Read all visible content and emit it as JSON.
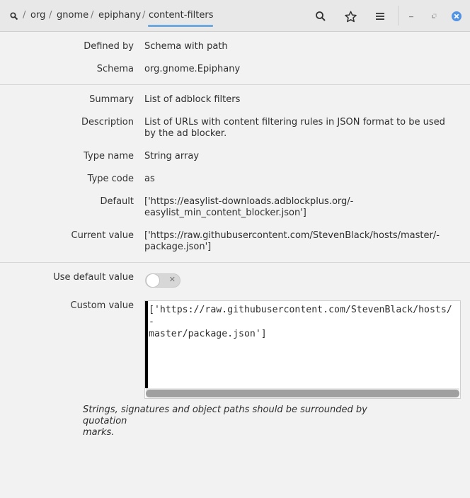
{
  "header": {
    "breadcrumbs": [
      "org",
      "gnome",
      "epiphany",
      "content-filters"
    ],
    "separator": "/",
    "icons": {
      "search": "search-icon",
      "bookmark": "star-icon",
      "menu": "hamburger-menu-icon",
      "minimize": "minimize-icon",
      "restore": "restore-icon",
      "close": "close-icon"
    }
  },
  "key_info": {
    "defined_by_label": "Defined by",
    "defined_by_value": "Schema with path",
    "schema_label": "Schema",
    "schema_value": "org.gnome.Epiphany"
  },
  "details": {
    "summary_label": "Summary",
    "summary_value": "List of adblock filters",
    "description_label": "Description",
    "description_value": "List of URLs with content filtering rules in JSON format to be used by the ad blocker.",
    "type_name_label": "Type name",
    "type_name_value": "String array",
    "type_code_label": "Type code",
    "type_code_value": "as",
    "default_label": "Default",
    "default_value_line1": "['https://easylist-downloads.adblockplus.org/-",
    "default_value_line2": "easylist_min_content_blocker.json']",
    "current_label": "Current value",
    "current_value_line1": "['https://raw.githubusercontent.com/StevenBlack/hosts/master/-",
    "current_value_line2": "package.json']"
  },
  "editor": {
    "use_default_label": "Use default value",
    "use_default_checked": false,
    "custom_label": "Custom value",
    "custom_value_line1": "['https://raw.githubusercontent.com/StevenBlack/hosts/-",
    "custom_value_line2": "master/package.json']",
    "hint_line1": "Strings, signatures and object paths should be surrounded by quotation",
    "hint_line2": "marks."
  },
  "colors": {
    "accent": "#6fa8dc",
    "close_button": "#5294e2"
  }
}
